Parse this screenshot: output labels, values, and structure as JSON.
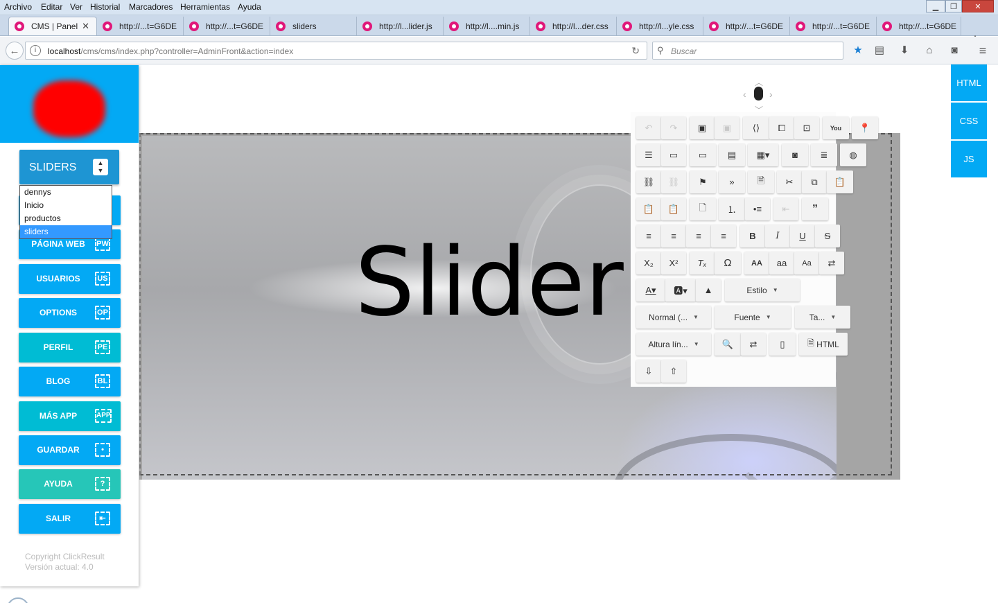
{
  "menubar": {
    "items": [
      "Archivo",
      "Editar",
      "Ver",
      "Historial",
      "Marcadores",
      "Herramientas",
      "Ayuda"
    ],
    "window_controls": [
      "minimize",
      "maximize",
      "close"
    ]
  },
  "tabs": [
    {
      "label": "CMS | Panel",
      "active": true
    },
    {
      "label": "http://...t=G6DE"
    },
    {
      "label": "http://...t=G6DE"
    },
    {
      "label": "sliders"
    },
    {
      "label": "http://l...lider.js"
    },
    {
      "label": "http://l....min.js"
    },
    {
      "label": "http://l...der.css"
    },
    {
      "label": "http://l...yle.css"
    },
    {
      "label": "http://...t=G6DE"
    },
    {
      "label": "http://...t=G6DE"
    },
    {
      "label": "http://...t=G6DE"
    }
  ],
  "navbar": {
    "url_host": "localhost",
    "url_path": "/cms/cms/index.php?controller=AdminFront&action=index",
    "search_placeholder": "Buscar"
  },
  "sidebar": {
    "select_label": "SLIDERS",
    "dropdown_options": [
      "dennys",
      "Inicio",
      "productos",
      "sliders"
    ],
    "dropdown_selected": "sliders",
    "buttons": [
      {
        "label": "PÁGINA WEB",
        "icon": "PW",
        "color": "blue"
      },
      {
        "label": "USUARIOS",
        "icon": "US",
        "color": "blue"
      },
      {
        "label": "OPTIONS",
        "icon": "OP",
        "color": "blue"
      },
      {
        "label": "PERFIL",
        "icon": "PE",
        "color": "cyan"
      },
      {
        "label": "BLOG",
        "icon": "BL",
        "color": "blue"
      },
      {
        "label": "MÁS APP",
        "icon": "APP",
        "color": "cyan"
      },
      {
        "label": "GUARDAR",
        "icon": "•",
        "color": "blue"
      },
      {
        "label": "AYUDA",
        "icon": "?",
        "color": "teal"
      },
      {
        "label": "SALIR",
        "icon": "⇤",
        "color": "blue"
      }
    ],
    "copyright": "Copyright ClickResult",
    "version": "Versión actual: 4.0"
  },
  "content": {
    "slider_title": "Slider"
  },
  "toolbar": {
    "style_label": "Estilo",
    "format_label": "Normal (...",
    "font_label": "Fuente",
    "size_label": "Ta...",
    "line_height_label": "Altura lín...",
    "html_label": "HTML",
    "text_icons": {
      "subscript": "X₂",
      "superscript": "X²",
      "remove_format": "Tₓ",
      "special_char": "Ω",
      "uppercase": "AA",
      "lowercase": "aa",
      "capitalize": "Aa"
    }
  },
  "right_tabs": [
    "HTML",
    "CSS",
    "JS"
  ],
  "colors": {
    "primary": "#03a9f4",
    "cyan": "#00bcd4",
    "teal": "#26c6b8",
    "select_bg": "#1e95d3"
  }
}
